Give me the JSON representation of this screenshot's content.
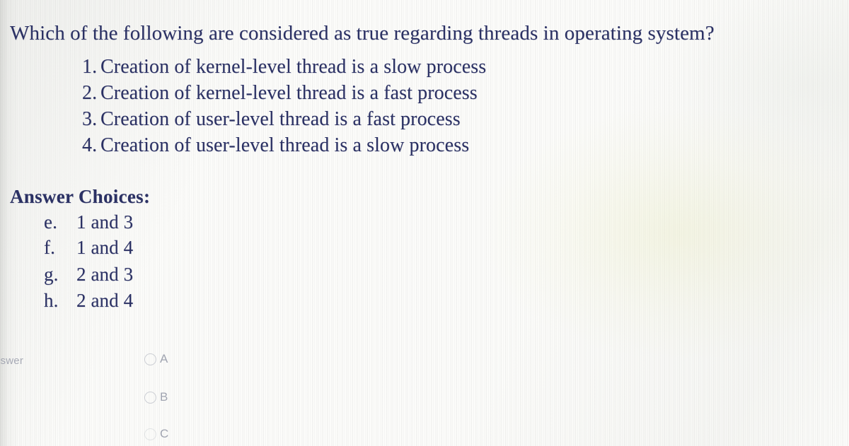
{
  "document": {
    "type": "exam-question-scan",
    "ink_color": "#2b3164",
    "paper_color": "#fcfcfa"
  },
  "question": {
    "prompt": "Which of the following are considered as true regarding threads in operating system?",
    "statements": [
      {
        "number": "1.",
        "text": "Creation of kernel-level thread is a slow process"
      },
      {
        "number": "2.",
        "text": "Creation of kernel-level thread is a fast process"
      },
      {
        "number": "3.",
        "text": "Creation of user-level thread is a fast process"
      },
      {
        "number": "4.",
        "text": "Creation of user-level thread is a slow process"
      }
    ]
  },
  "answer_choices": {
    "heading": "Answer Choices:",
    "options": [
      {
        "letter": "e.",
        "text": "1 and 3"
      },
      {
        "letter": "f.",
        "text": "1 and 4"
      },
      {
        "letter": "g.",
        "text": "2 and 3"
      },
      {
        "letter": "h.",
        "text": "2 and 4"
      }
    ]
  },
  "ghost_overlay": {
    "label": "nswer",
    "options": [
      {
        "letter": "A"
      },
      {
        "letter": "B"
      },
      {
        "letter": "C"
      }
    ]
  }
}
